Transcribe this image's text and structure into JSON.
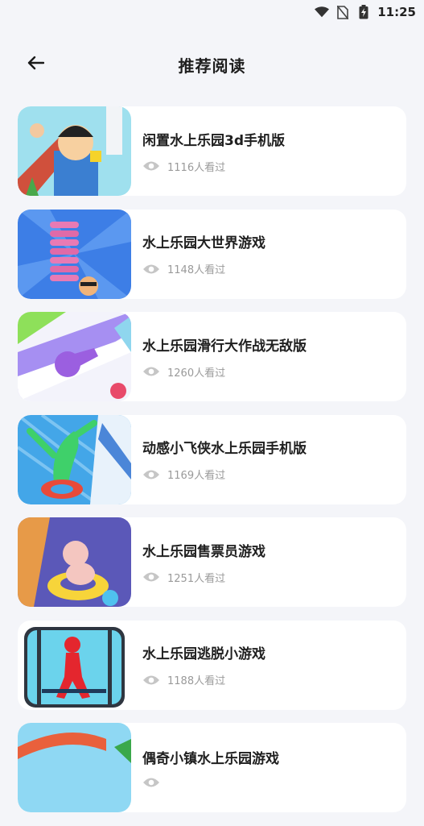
{
  "status_bar": {
    "time": "11:25"
  },
  "header": {
    "title": "推荐阅读"
  },
  "articles": [
    {
      "title": "闲置水上乐园3d手机版",
      "views": "1116人看过"
    },
    {
      "title": "水上乐园大世界游戏",
      "views": "1148人看过"
    },
    {
      "title": "水上乐园滑行大作战无敌版",
      "views": "1260人看过"
    },
    {
      "title": "动感小飞侠水上乐园手机版",
      "views": "1169人看过"
    },
    {
      "title": "水上乐园售票员游戏",
      "views": "1251人看过"
    },
    {
      "title": "水上乐园逃脱小游戏",
      "views": "1188人看过"
    },
    {
      "title": "偶奇小镇水上乐园游戏",
      "views": ""
    }
  ]
}
